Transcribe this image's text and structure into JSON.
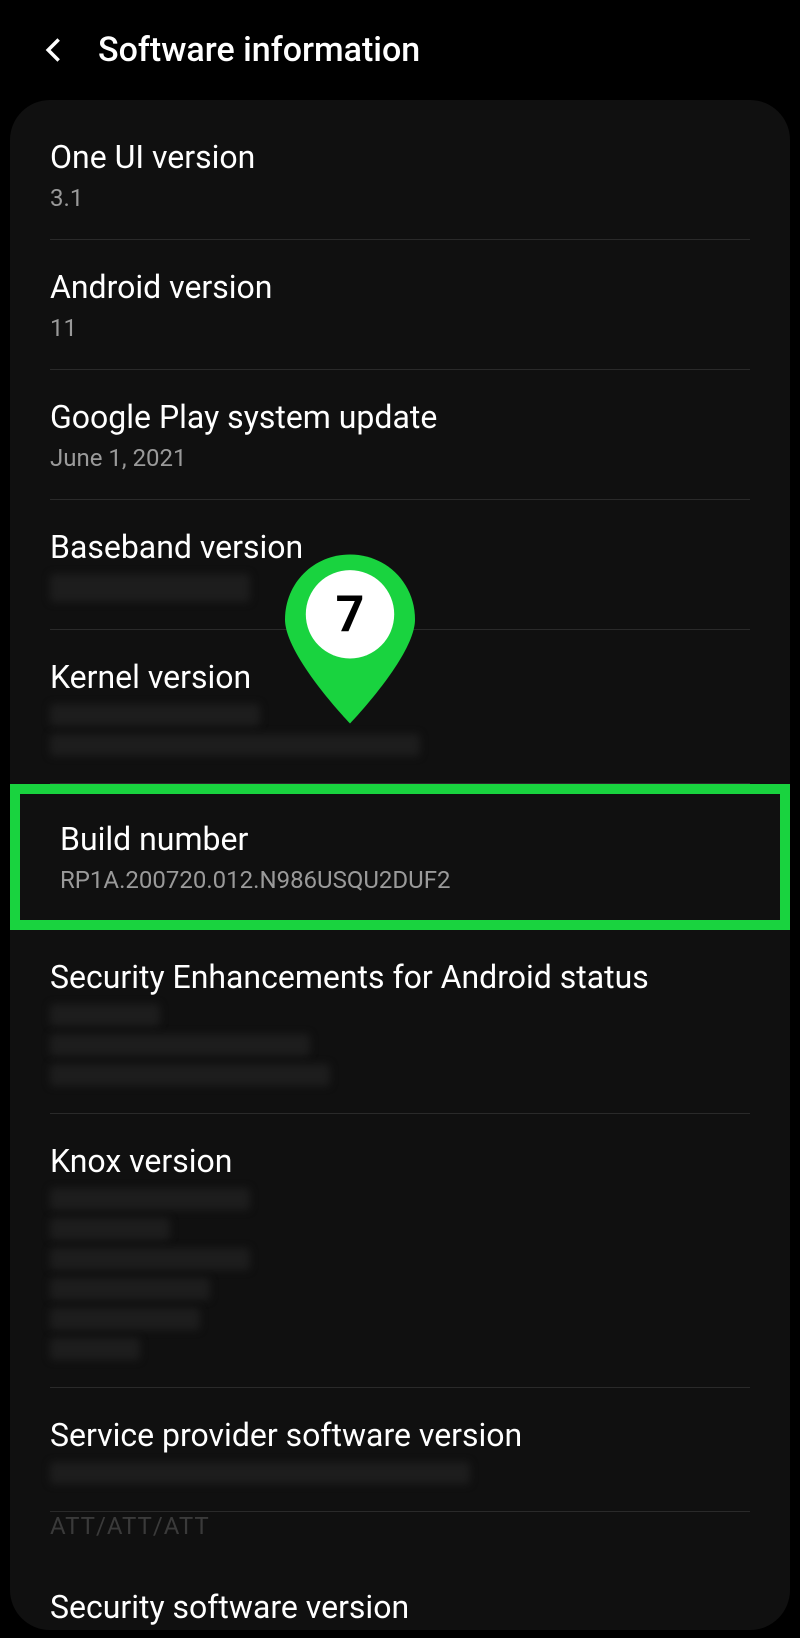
{
  "header": {
    "title": "Software information"
  },
  "items": {
    "one_ui": {
      "title": "One UI version",
      "value": "3.1"
    },
    "android": {
      "title": "Android version",
      "value": "11"
    },
    "play_update": {
      "title": "Google Play system update",
      "value": "June 1, 2021"
    },
    "baseband": {
      "title": "Baseband version"
    },
    "kernel": {
      "title": "Kernel version"
    },
    "build": {
      "title": "Build number",
      "value": "RP1A.200720.012.N986USQU2DUF2"
    },
    "se_android": {
      "title": "Security Enhancements for Android status"
    },
    "knox": {
      "title": "Knox version"
    },
    "spsv": {
      "title": "Service provider software version"
    },
    "sec_sw": {
      "title": "Security software version"
    }
  },
  "callout": {
    "label": "7"
  },
  "trunc_hint": "ATT/ATT/ATT"
}
